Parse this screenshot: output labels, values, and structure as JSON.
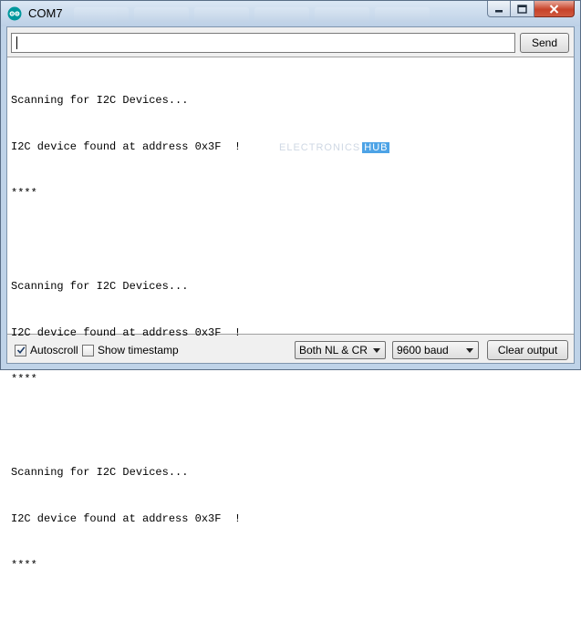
{
  "window": {
    "title": "COM7",
    "app_icon": "arduino-icon",
    "controls": [
      "minimize-icon",
      "maximize-icon",
      "close-icon"
    ]
  },
  "input": {
    "value": ""
  },
  "send_button": {
    "label": "Send"
  },
  "output": {
    "lines": [
      "Scanning for I2C Devices...",
      "I2C device found at address 0x3F  !",
      "****",
      "",
      "Scanning for I2C Devices...",
      "I2C device found at address 0x3F  !",
      "****",
      "",
      "Scanning for I2C Devices...",
      "I2C device found at address 0x3F  !",
      "****"
    ]
  },
  "watermark": {
    "text": "ELECTRONICS",
    "hub_text": "HUB"
  },
  "bottom": {
    "autoscroll": {
      "label": "Autoscroll",
      "checked": true
    },
    "show_timestamp": {
      "label": "Show timestamp",
      "checked": false
    },
    "line_ending": {
      "selected": "Both NL & CR"
    },
    "baud_rate": {
      "selected": "9600 baud"
    },
    "clear_button": {
      "label": "Clear output"
    }
  },
  "colors": {
    "accent_icon": "#00979d",
    "close_button": "#c7432a",
    "watermark_hub": "#4da3e6"
  }
}
